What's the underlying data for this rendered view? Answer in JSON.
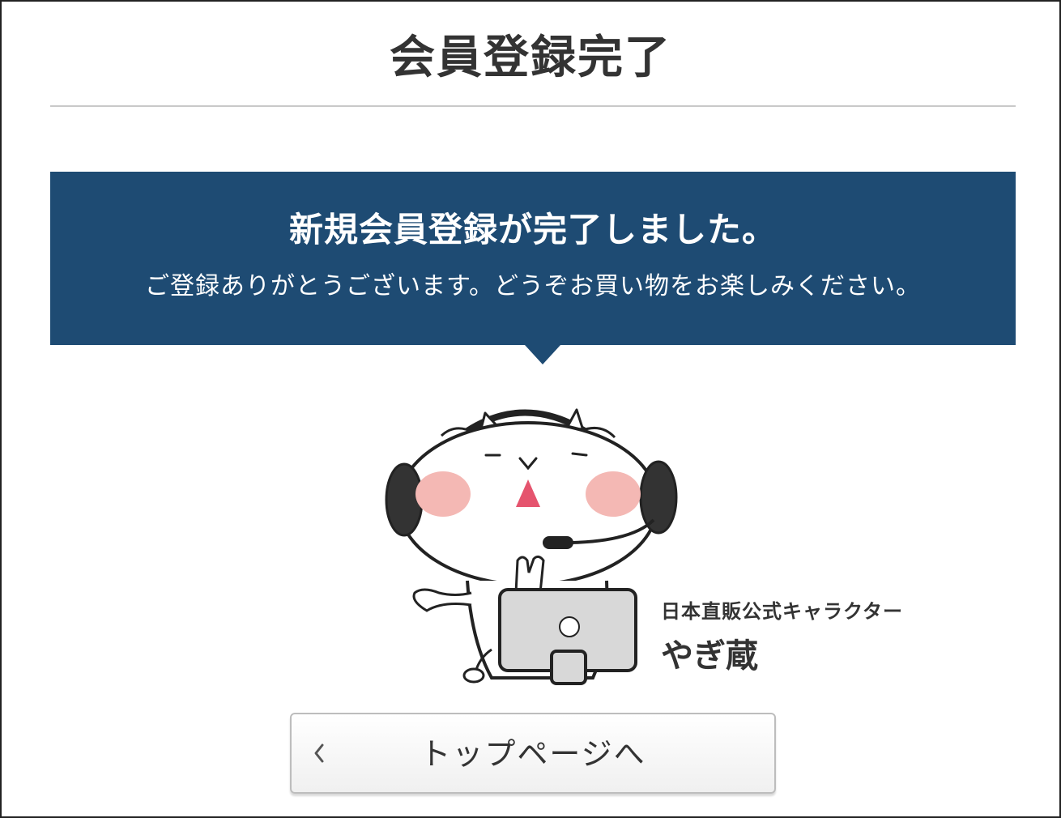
{
  "page": {
    "title": "会員登録完了"
  },
  "banner": {
    "heading": "新規会員登録が完了しました。",
    "message": "ご登録ありがとうございます。どうぞお買い物をお楽しみください。",
    "background_color": "#1e4b73"
  },
  "character": {
    "subtitle": "日本直販公式キャラクター",
    "name": "やぎ蔵",
    "image_icon": "goat-mascot-with-headset-and-laptop"
  },
  "navigation": {
    "top_page_button_label": "トップページへ",
    "back_icon": "chevron-left-icon"
  }
}
